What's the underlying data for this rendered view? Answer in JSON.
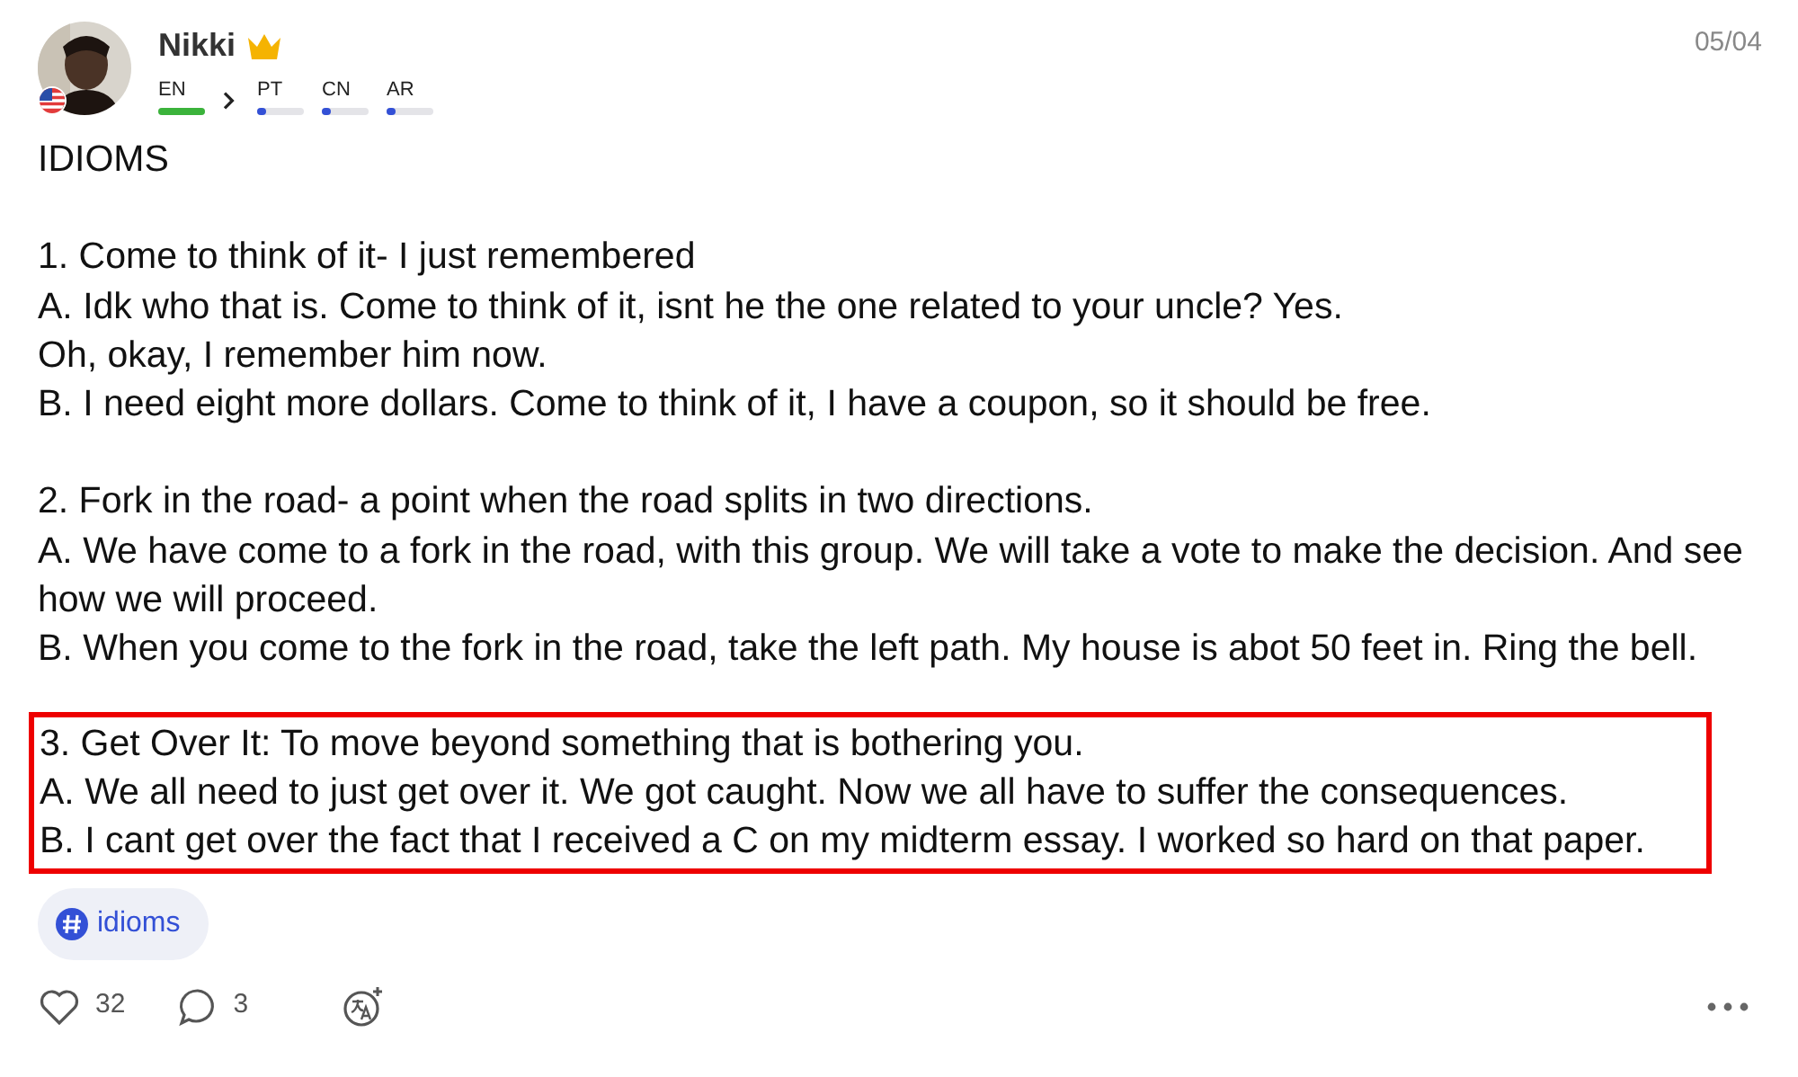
{
  "post": {
    "author": "Nikki",
    "premium": true,
    "date": "05/04",
    "languages": [
      {
        "code": "EN",
        "native": true,
        "level": 1
      },
      {
        "code": "PT",
        "native": false,
        "level": 0.15
      },
      {
        "code": "CN",
        "native": false,
        "level": 0.15
      },
      {
        "code": "AR",
        "native": false,
        "level": 0.15
      }
    ],
    "title": "IDIOMS",
    "blocks": [
      {
        "highlighted": false,
        "lines": [
          "1. Come to think of it- I just remembered",
          "A. Idk who that is. Come to think of it, isnt he the one related to your uncle? Yes.",
          "Oh, okay, I remember him now.",
          "B. I need eight more dollars. Come to think of it, I have a coupon, so it should be free."
        ]
      },
      {
        "highlighted": false,
        "lines": [
          "2. Fork in the road- a point when the road splits in two directions.",
          "A. We have come to a fork in the road, with this group. We will take a vote to make the decision. And see how we will proceed.",
          "B. When you come to the fork in the road, take the left path. My house is abot 50 feet in. Ring the bell."
        ]
      },
      {
        "highlighted": true,
        "lines": [
          "3. Get Over It: To move beyond something that is bothering you.",
          "A. We all need to just get over it. We got caught. Now we all have to suffer the consequences.",
          "B. I cant get over the fact that I received a C on my midterm essay. I worked so hard on that paper."
        ]
      }
    ],
    "tag": "idioms",
    "likes": "32",
    "comments": "3"
  }
}
